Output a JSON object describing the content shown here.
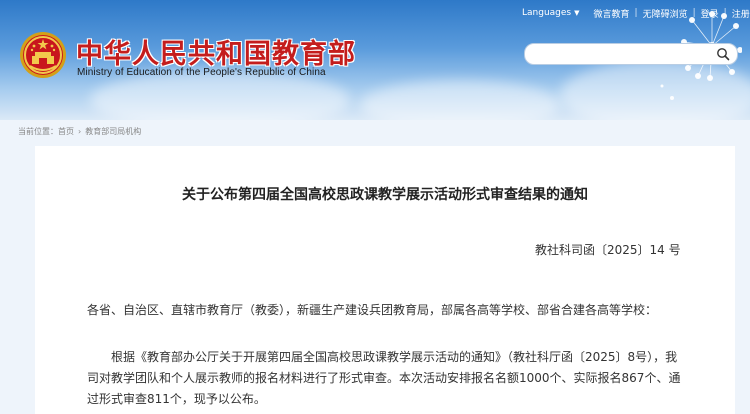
{
  "header": {
    "top_links": {
      "languages": "Languages",
      "languages_caret": "▼",
      "weibo": "微言教育",
      "accessibility": "无障碍浏览",
      "login": "登录",
      "register": "注册",
      "separator": "|"
    },
    "title_cn": "中华人民共和国教育部",
    "title_en": "Ministry of Education of the People's Republic of China",
    "search": {
      "value": "",
      "placeholder": ""
    },
    "colors": {
      "title_red": "#c41d1d",
      "sky_blue": "#2e79c8"
    }
  },
  "breadcrumb": {
    "prefix": "当前位置：",
    "items": [
      "首页",
      "教育部司局机构"
    ],
    "separator": "›"
  },
  "article": {
    "title": "关于公布第四届全国高校思政课教学展示活动形式审查结果的通知",
    "doc_number": "教社科司函〔2025〕14 号",
    "salutation": "各省、自治区、直辖市教育厅（教委），新疆生产建设兵团教育局，部属各高等学校、部省合建各高等学校：",
    "body_lines": [
      "根据《教育部办公厅关于开展第四届全国高校思政课教学展示活动的通知》（教社科厅函〔2025〕8号），我",
      "司对教学团队和个人展示教师的报名材料进行了形式审查。本次活动安排报名名额1000个、实际报名867个、通",
      "过形式审查811个，现予以公布。"
    ]
  }
}
